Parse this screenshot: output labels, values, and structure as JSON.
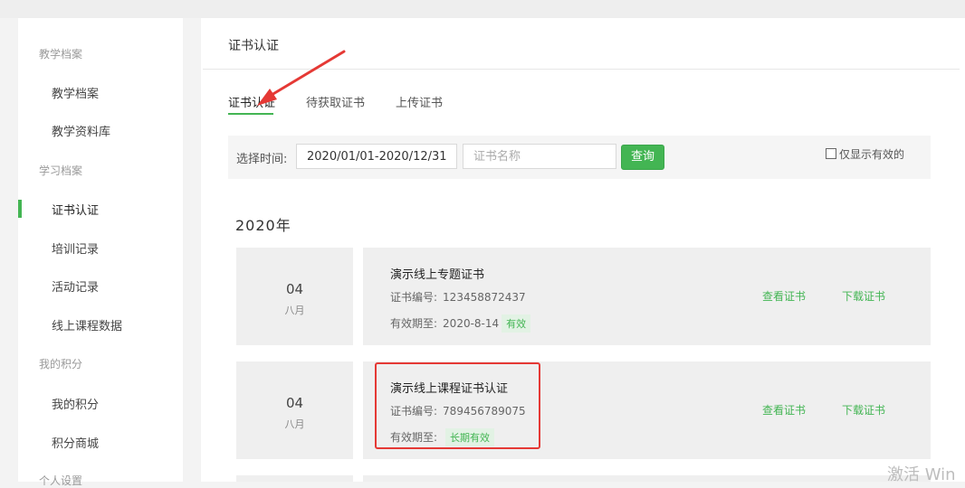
{
  "sidebar": {
    "groups": [
      {
        "label": "教学档案",
        "items": [
          "教学档案",
          "教学资料库"
        ]
      },
      {
        "label": "学习档案",
        "items": [
          "证书认证",
          "培训记录",
          "活动记录",
          "线上课程数据"
        ]
      },
      {
        "label": "我的积分",
        "items": [
          "我的积分",
          "积分商城"
        ]
      },
      {
        "label": "个人设置",
        "items": []
      }
    ],
    "active_item": "证书认证"
  },
  "main": {
    "title": "证书认证",
    "tabs": [
      {
        "label": "证书认证",
        "active": true
      },
      {
        "label": "待获取证书",
        "active": false
      },
      {
        "label": "上传证书",
        "active": false
      }
    ]
  },
  "filter": {
    "label": "选择时间:",
    "date_range": "2020/01/01-2020/12/31",
    "name_placeholder": "证书名称",
    "query_label": "查询",
    "valid_only_label": "仅显示有效的",
    "valid_only_checked": false
  },
  "year_heading": "2020年",
  "certificates": [
    {
      "day": "04",
      "month": "八月",
      "title": "演示线上专题证书",
      "number_label": "证书编号:",
      "number": "123458872437",
      "expiry_label": "有效期至:",
      "expiry": "2020-8-14",
      "status": "有效",
      "view_label": "查看证书",
      "download_label": "下载证书"
    },
    {
      "day": "04",
      "month": "八月",
      "title": "演示线上课程证书认证",
      "number_label": "证书编号:",
      "number": "789456789075",
      "expiry_label": "有效期至:",
      "expiry": "",
      "status": "长期有效",
      "view_label": "查看证书",
      "download_label": "下载证书"
    }
  ],
  "watermark": "激活 Win",
  "colors": {
    "accent": "#43b553",
    "annotation_red": "#e53935",
    "background": "#f3f3f3",
    "card_background": "#efefef"
  }
}
